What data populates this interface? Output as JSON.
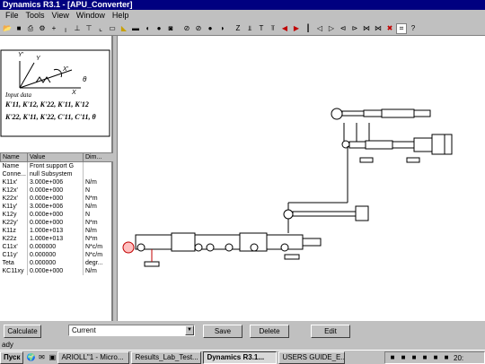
{
  "window": {
    "title": "Dynamics R3.1 - [APU_Converter]"
  },
  "menu": [
    "File",
    "Tools",
    "View",
    "Window",
    "Help"
  ],
  "toolbar": {
    "help_glyph": "?"
  },
  "preview": {
    "axis_y_prime": "Y'",
    "axis_y": "Y",
    "axis_x_prime": "X'",
    "axis_x": "X",
    "angle": "θ",
    "caption": "Input data",
    "eq1": "K'11, K'12, K'22, K'11, K'12",
    "eq2": "K'22, K'11, K'22, C'11, C'11, θ"
  },
  "grid": {
    "headers": [
      "Name",
      "Value",
      "Dim..."
    ],
    "rows": [
      [
        "Name",
        "Front support G",
        ""
      ],
      [
        "Conne...",
        "null Subsystem",
        ""
      ],
      [
        "K11x'",
        "3.000e+006",
        "N/m"
      ],
      [
        "K12x'",
        "0.000e+000",
        "N"
      ],
      [
        "K22x'",
        "0.000e+000",
        "N*m"
      ],
      [
        "K11y'",
        "3.000e+006",
        "N/m"
      ],
      [
        "K12y",
        "0.000e+000",
        "N"
      ],
      [
        "K22y'",
        "0.000e+000",
        "N*m"
      ],
      [
        "K11z",
        "1.000e+013",
        "N/m"
      ],
      [
        "K22z",
        "1.000e+013",
        "N*m"
      ],
      [
        "C11x'",
        "0.000000",
        "N*c/m"
      ],
      [
        "C11y'",
        "0.000000",
        "N*c/m"
      ],
      [
        "Teta",
        "0.000000",
        "degr..."
      ],
      [
        "KC11xy",
        "0.000e+000",
        "N/m"
      ]
    ]
  },
  "bottom": {
    "calculate": "Calculate",
    "combo_value": "Current",
    "save": "Save",
    "delete": "Delete",
    "edit": "Edit"
  },
  "status": {
    "text": "ady"
  },
  "taskbar": {
    "start": "Пуск",
    "tasks": [
      "ARIOLL\"1 - Micro...",
      "Results_Lab_Test...",
      "Dynamics R3.1...",
      "USERS GUIDE_E..."
    ],
    "clock": "20:"
  },
  "colors": {
    "titlebar": "#000080",
    "selection": "#c00000"
  }
}
